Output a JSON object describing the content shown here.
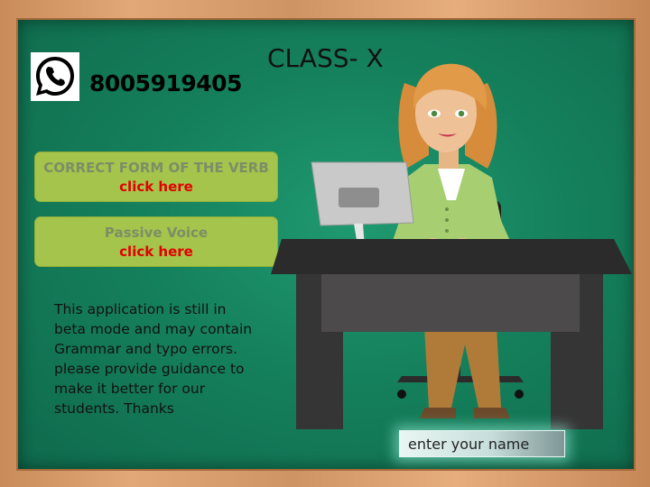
{
  "app": {
    "phone": "8005919405",
    "title": "CLASS- X"
  },
  "menu": [
    {
      "title": "CORRECT FORM OF THE VERB",
      "link": "click here"
    },
    {
      "title": "Passive Voice",
      "link": "click here"
    }
  ],
  "notice": "This application is still in beta mode and may contain Grammar and typo errors. please provide guidance to make it better for our students. Thanks",
  "name_input": {
    "placeholder": "enter your name",
    "value": ""
  },
  "icons": [
    "whatsapp-icon"
  ],
  "colors": {
    "board": "#15805c",
    "button": "#a4c44b",
    "link": "#e20000",
    "frame": "#d79c6c"
  }
}
